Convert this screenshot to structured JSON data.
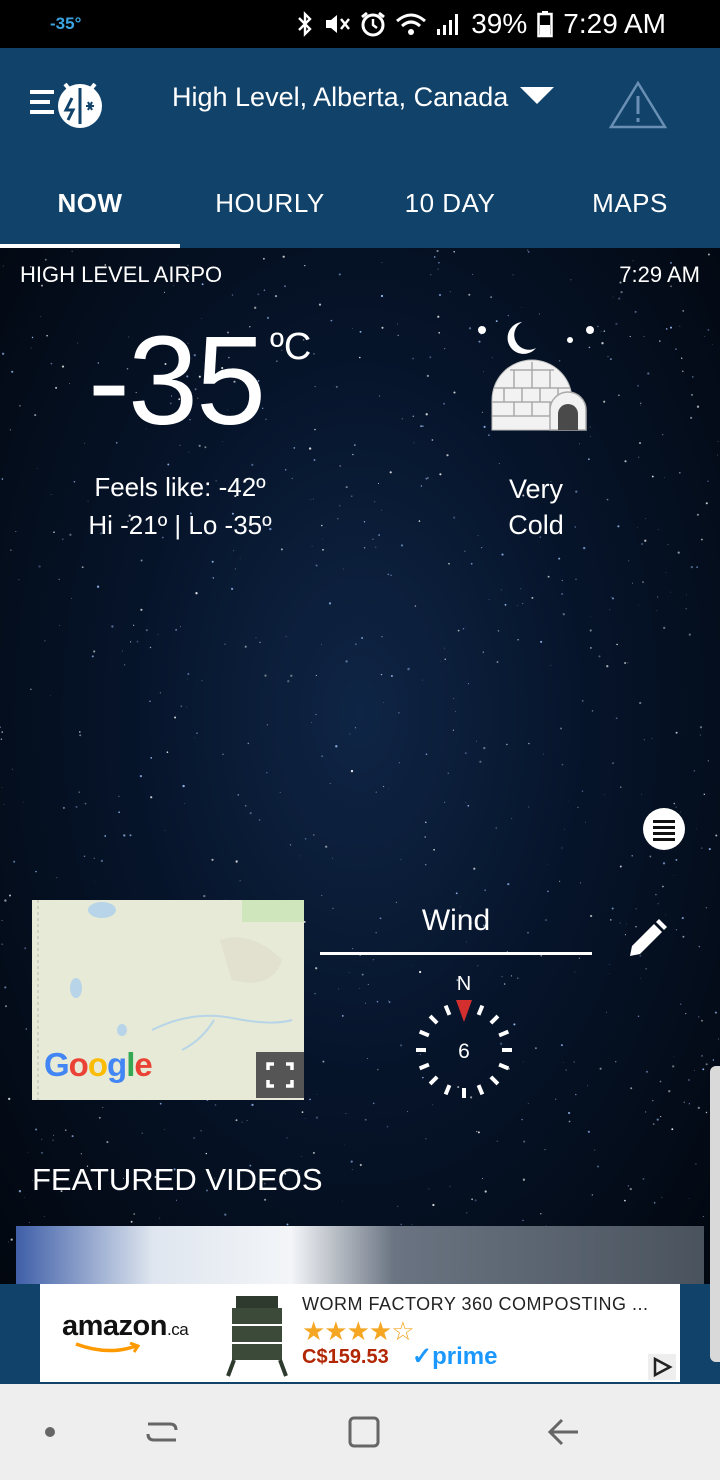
{
  "status_bar": {
    "temperature": "-35°",
    "battery": "39%",
    "time": "7:29 AM"
  },
  "header": {
    "location": "High Level, Alberta, Canada",
    "menu_icon": "menu-logo-icon",
    "alert_icon": "warning-triangle-icon"
  },
  "tabs": [
    {
      "label": "NOW",
      "active": true
    },
    {
      "label": "HOURLY",
      "active": false
    },
    {
      "label": "10 DAY",
      "active": false
    },
    {
      "label": "MAPS",
      "active": false
    }
  ],
  "current": {
    "station": "HIGH LEVEL AIRPO",
    "time": "7:29 AM",
    "temperature": "-35",
    "unit": "ºC",
    "feels_like": "Feels like:  -42º",
    "hi_lo": "Hi -21º  |  Lo -35º",
    "condition_line1": "Very",
    "condition_line2": "Cold",
    "condition_icon": "igloo-night-icon"
  },
  "wind": {
    "title": "Wind",
    "direction_label": "N",
    "speed": "6"
  },
  "map": {
    "provider": "Google"
  },
  "featured": {
    "title": "FEATURED VIDEOS"
  },
  "ad": {
    "brand": "amazon",
    "brand_suffix": ".ca",
    "title": "WORM FACTORY 360 COMPOSTING ...",
    "stars": "★★★★☆",
    "rating": 4,
    "price": "C$159.53",
    "prime": "prime"
  },
  "colors": {
    "header_bg": "#10426a",
    "accent_blue": "#3aa4e0",
    "price_red": "#b12704",
    "star_gold": "#f5a623"
  }
}
